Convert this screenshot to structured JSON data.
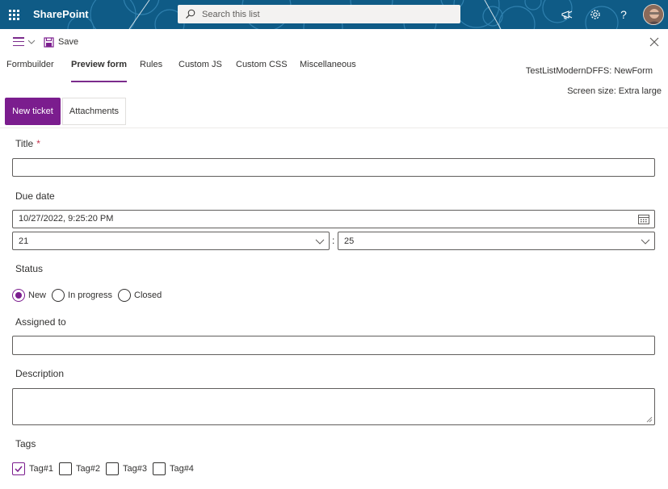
{
  "suite_bar": {
    "brand": "SharePoint",
    "search_placeholder": "Search this list",
    "icons": [
      "waffle-icon",
      "megaphone-icon",
      "gear-icon",
      "help-icon"
    ]
  },
  "command_bar": {
    "save_label": "Save"
  },
  "tabs": [
    {
      "label": "Formbuilder"
    },
    {
      "label": "Preview form"
    },
    {
      "label": "Rules"
    },
    {
      "label": "Custom JS"
    },
    {
      "label": "Custom CSS"
    },
    {
      "label": "Miscellaneous"
    }
  ],
  "form_name": "TestListModernDFFS: NewForm",
  "screen_size": "Screen size: Extra large",
  "form_tabs": [
    {
      "label": "New ticket"
    },
    {
      "label": "Attachments"
    }
  ],
  "fields": {
    "title": {
      "label": "Title",
      "required_mark": "*",
      "value": ""
    },
    "due_date": {
      "label": "Due date",
      "value": "10/27/2022, 9:25:20 PM",
      "hour": "21",
      "minute": "25",
      "separator": ":"
    },
    "status": {
      "label": "Status",
      "options": [
        "New",
        "In progress",
        "Closed"
      ],
      "selected": "New"
    },
    "assigned_to": {
      "label": "Assigned to",
      "value": ""
    },
    "description": {
      "label": "Description",
      "value": ""
    },
    "tags": {
      "label": "Tags",
      "options": [
        "Tag#1",
        "Tag#2",
        "Tag#3",
        "Tag#4"
      ],
      "checked": [
        "Tag#1"
      ]
    }
  },
  "colors": {
    "accent": "#7b1d8e",
    "suite_bar": "#0f5b86"
  }
}
